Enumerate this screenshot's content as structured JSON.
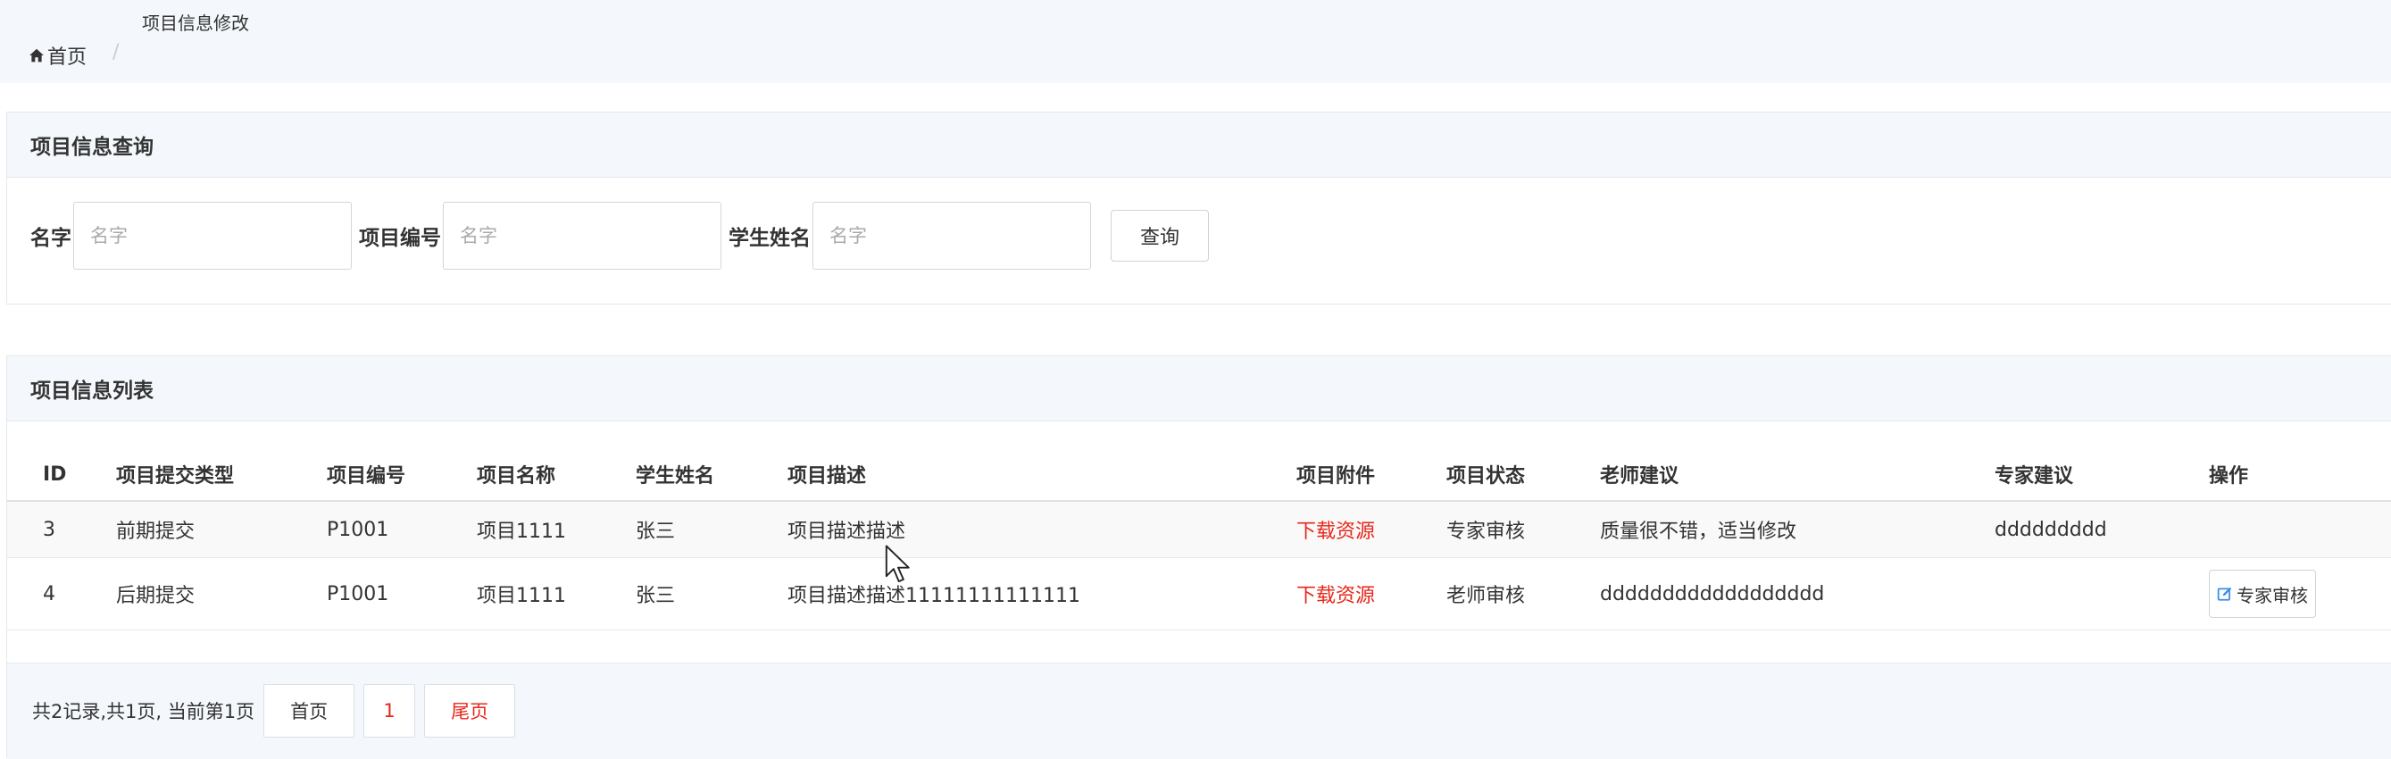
{
  "breadcrumb": {
    "home": "首页",
    "separator": "/",
    "current": "项目信息修改"
  },
  "search_panel": {
    "title": "项目信息查询",
    "fields": [
      {
        "label": "名字",
        "placeholder": "名字",
        "value": ""
      },
      {
        "label": "项目编号",
        "placeholder": "名字",
        "value": ""
      },
      {
        "label": "学生姓名",
        "placeholder": "名字",
        "value": ""
      }
    ],
    "query_button": "查询"
  },
  "list_panel": {
    "title": "项目信息列表",
    "columns": [
      "ID",
      "项目提交类型",
      "项目编号",
      "项目名称",
      "学生姓名",
      "项目描述",
      "项目附件",
      "项目状态",
      "老师建议",
      "专家建议",
      "操作"
    ],
    "rows": [
      {
        "id": "3",
        "type": "前期提交",
        "code": "P1001",
        "name": "项目1111",
        "student": "张三",
        "description": "项目描述描述",
        "attachment": "下载资源",
        "status": "专家审核",
        "teacher_advice": "质量很不错，适当修改",
        "expert_advice": "ddddddddd",
        "action": ""
      },
      {
        "id": "4",
        "type": "后期提交",
        "code": "P1001",
        "name": "项目1111",
        "student": "张三",
        "description": "项目描述描述11111111111111",
        "attachment": "下载资源",
        "status": "老师审核",
        "teacher_advice": "dddddddddddddddddd",
        "expert_advice": "",
        "action": "专家审核"
      }
    ]
  },
  "pagination": {
    "summary": "共2记录,共1页, 当前第1页",
    "first": "首页",
    "current_page": "1",
    "last": "尾页"
  },
  "colors": {
    "header_bg": "#f4f8fc",
    "border": "#e3e8ee",
    "link_red": "#e8271a",
    "text": "#333333",
    "edit_icon_blue": "#3d8ee8"
  },
  "icons": {
    "home": "home-icon",
    "edit": "edit-icon",
    "cursor": "mouse-pointer-icon"
  }
}
